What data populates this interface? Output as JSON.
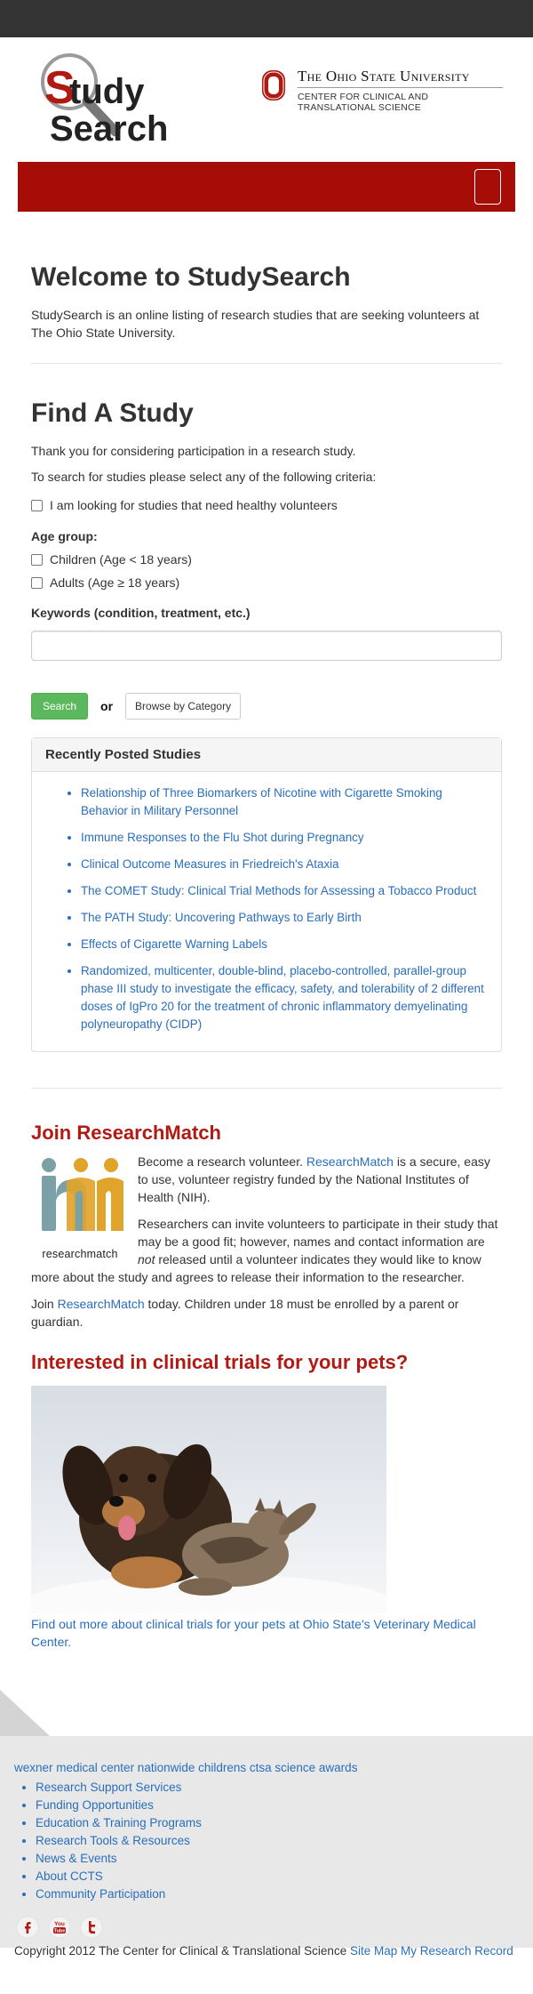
{
  "header": {
    "logo_text": [
      "Study",
      "Search"
    ],
    "osu_name": "The Ohio State University",
    "osu_sub_line1": "CENTER FOR CLINICAL AND",
    "osu_sub_line2": "TRANSLATIONAL SCIENCE"
  },
  "colors": {
    "brand_red": "#a50d06",
    "link": "#2a6ebb",
    "success": "#5cb85c"
  },
  "welcome": {
    "title": "Welcome to StudySearch",
    "text": "StudySearch is an online listing of research studies that are seeking volunteers at The Ohio State University."
  },
  "find": {
    "title": "Find A Study",
    "thanks": "Thank you for considering participation in a research study.",
    "instructions": "To search for studies please select any of the following criteria:",
    "healthy_label": "I am looking for studies that need healthy volunteers",
    "age_group_label": "Age group:",
    "children_label": "Children (Age < 18 years)",
    "adults_label": "Adults (Age ≥ 18 years)",
    "keywords_label": "Keywords (condition, treatment, etc.)",
    "keywords_value": "",
    "search_button": "Search",
    "or_text": "or",
    "browse_button": "Browse by Category"
  },
  "recent": {
    "title": "Recently Posted Studies",
    "items": [
      "Relationship of Three Biomarkers of Nicotine with Cigarette Smoking Behavior in Military Personnel",
      "Immune Responses to the Flu Shot during Pregnancy",
      "Clinical Outcome Measures in Friedreich's Ataxia",
      "The COMET Study: Clinical Trial Methods for Assessing a Tobacco Product",
      "The PATH Study: Uncovering Pathways to Early Birth",
      "Effects of Cigarette Warning Labels",
      "Randomized, multicenter, double-blind, placebo-controlled, parallel-group phase III study to investigate the efficacy, safety, and tolerability of 2 different doses of IgPro 20 for the treatment of chronic inflammatory demyelinating polyneuropathy (CIDP)"
    ]
  },
  "researchmatch": {
    "title": "Join ResearchMatch",
    "logo_caption": "researchmatch",
    "p1_before": "Become a research volunteer. ",
    "p1_link": "ResearchMatch",
    "p1_after": " is a secure, easy to use, volunteer registry funded by the National Institutes of Health (NIH).",
    "p2_before": "Researchers can invite volunteers to participate in their study that may be a good fit; however, names and contact information are ",
    "p2_em": "not",
    "p2_after": " released until a volunteer indicates they would like to know more about the study and agrees to release their information to the researcher.",
    "p3_before": "Join ",
    "p3_link": "ResearchMatch",
    "p3_after": " today. Children under 18 must be enrolled by a parent or guardian."
  },
  "pets": {
    "title": "Interested in clinical trials for your pets?",
    "link_text": "Find out more about clinical trials for your pets at Ohio State's Veterinary Medical Center."
  },
  "footer": {
    "top_links": "wexner medical center nationwide childrens ctsa science awards",
    "links": [
      "Research Support Services",
      "Funding Opportunities",
      "Education & Training Programs",
      "Research Tools & Resources",
      "News & Events",
      "About CCTS",
      "Community Participation"
    ],
    "social_icons": [
      "facebook-icon",
      "youtube-icon",
      "twitter-icon"
    ],
    "copyright": "Copyright 2012 The Center for Clinical & Translational Science",
    "sitemap_link": "Site Map",
    "record_link": "My Research Record"
  }
}
